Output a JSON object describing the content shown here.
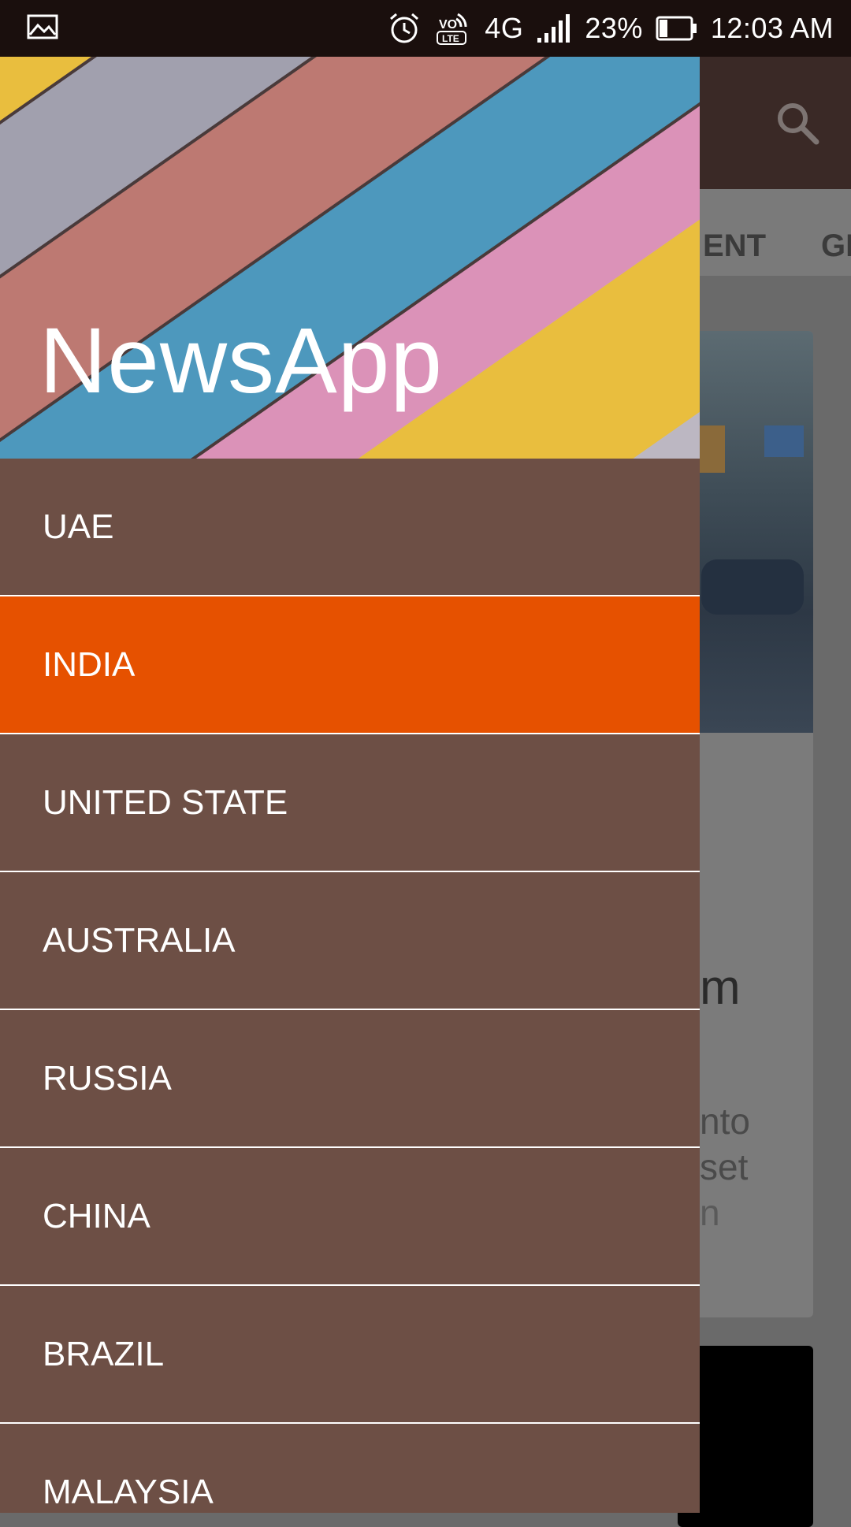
{
  "status_bar": {
    "network": "4G",
    "battery": "23%",
    "time": "12:03 AM",
    "icons": [
      "gallery-icon",
      "alarm-icon",
      "volte-icon",
      "signal-icon",
      "battery-icon"
    ]
  },
  "toolbar": {
    "search_icon": "search-icon"
  },
  "background": {
    "tab_fragment_1": "ENT",
    "tab_fragment_2": "GI",
    "card_headline_fragment": "m",
    "card_text_fragments": [
      "nto",
      "set",
      "n"
    ]
  },
  "drawer": {
    "app_title": "NewsApp",
    "selected_index": 1,
    "items": [
      {
        "label": "UAE"
      },
      {
        "label": "INDIA"
      },
      {
        "label": "UNITED STATE"
      },
      {
        "label": "AUSTRALIA"
      },
      {
        "label": "RUSSIA"
      },
      {
        "label": "CHINA"
      },
      {
        "label": "BRAZIL"
      },
      {
        "label": "MALAYSIA"
      }
    ]
  },
  "colors": {
    "status_bar": "#1a0f0d",
    "drawer_background": "#6d4f45",
    "selected_item": "#e65100",
    "toolbar": "#3a2926"
  }
}
